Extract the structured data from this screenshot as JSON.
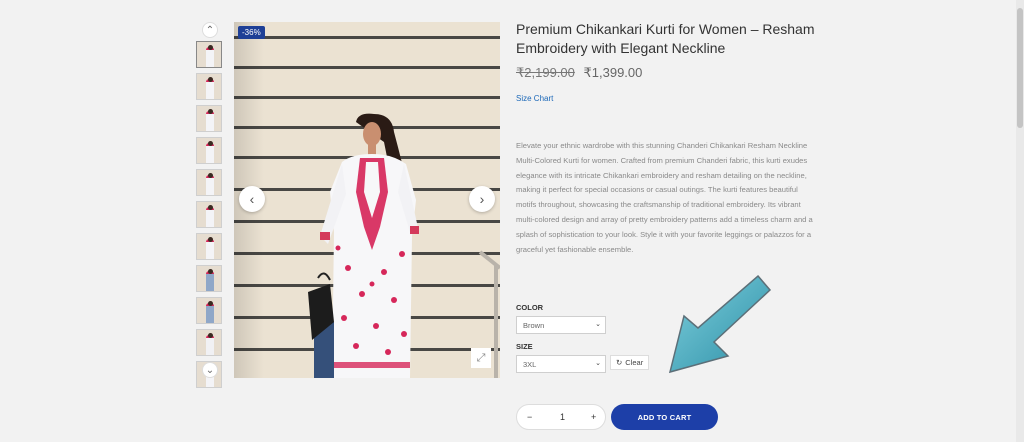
{
  "product": {
    "title": "Premium Chikankari Kurti for Women – Resham Embroidery with Elegant Neckline",
    "price_old": "₹2,199.00",
    "price_new": "₹1,399.00",
    "size_chart_label": "Size Chart",
    "description": "Elevate your ethnic wardrobe with this stunning Chanderi Chikankari Resham Neckline Multi-Colored Kurti for women. Crafted from premium Chanderi fabric, this kurti exudes elegance with its intricate Chikankari embroidery and resham detailing on the neckline, making it perfect for special occasions or casual outings. The kurti features beautiful motifs throughout, showcasing the craftsmanship of traditional embroidery. Its vibrant multi-colored design and array of pretty embroidery patterns add a timeless charm and a splash of sophistication to your look. Style it with your favorite leggings or palazzos for a graceful yet fashionable ensemble."
  },
  "gallery": {
    "discount_badge": "-36%",
    "prev_icon": "chevron-left-icon",
    "next_icon": "chevron-right-icon",
    "zoom_icon": "expand-icon",
    "thumbnail_count": 11
  },
  "options": {
    "color_label": "COLOR",
    "color_value": "Brown",
    "size_label": "SIZE",
    "size_value": "3XL",
    "clear_label": "Clear"
  },
  "cart": {
    "minus": "−",
    "quantity": "1",
    "plus": "+",
    "add_label": "ADD TO CART"
  },
  "colors": {
    "accent": "#1d3fa8",
    "badge": "#1e3f96",
    "link": "#1c68b8",
    "annotation_arrow": "#3aa3b8"
  }
}
